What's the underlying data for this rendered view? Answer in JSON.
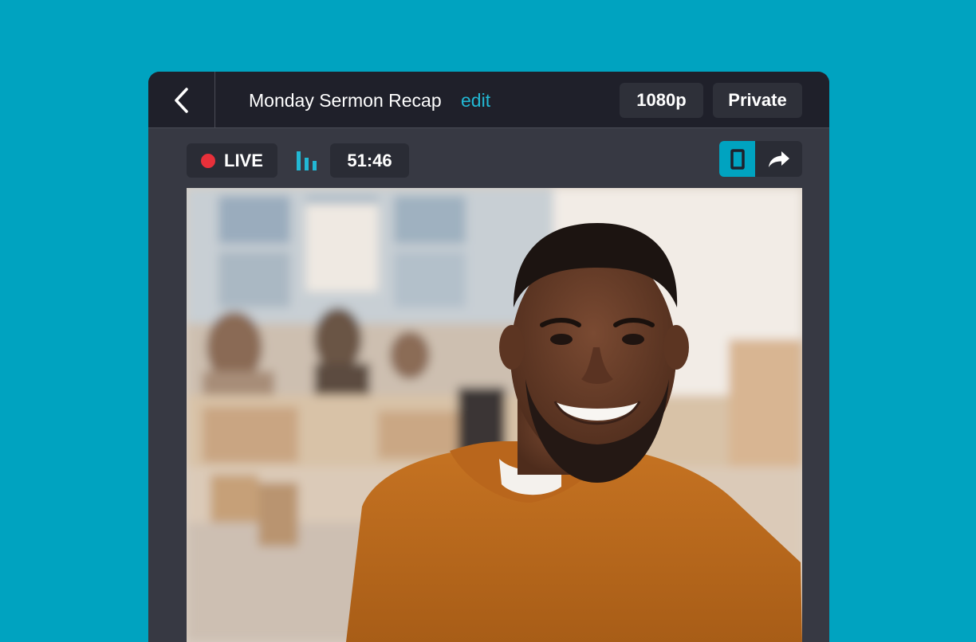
{
  "header": {
    "title": "Monday Sermon Recap",
    "edit_label": "edit",
    "resolution_label": "1080p",
    "privacy_label": "Private"
  },
  "toolbar": {
    "live_label": "LIVE",
    "timer": "51:46"
  },
  "icons": {
    "back": "chevron-left-icon",
    "stats": "bar-chart-icon",
    "layout": "portrait-layout-icon",
    "share": "share-arrow-icon"
  },
  "colors": {
    "background": "#00a3c0",
    "accent": "#22b8d4",
    "live": "#e8303a",
    "header": "#1f202a",
    "panel": "#373943"
  }
}
